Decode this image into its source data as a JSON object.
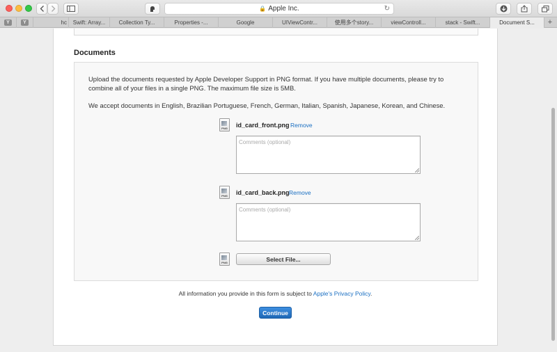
{
  "browser": {
    "address": "Apple Inc.",
    "pinned_tabs": [
      "Y",
      "Y"
    ],
    "tabs": [
      "hc",
      "Swift: Array...",
      "Collection Ty...",
      "Properties -...",
      "Google",
      "UIViewContr...",
      "使用多个story...",
      "viewControll...",
      "stack - Swift...",
      "Document S..."
    ],
    "new_tab_label": "+"
  },
  "page": {
    "section_title": "Documents",
    "intro_text": "Upload the documents requested by Apple Developer Support in PNG format. If you have multiple documents, please try to combine all of your files in a single PNG. The maximum file size is 5MB.",
    "accepted_text": "We accept documents in English, Brazilian Portuguese, French, German, Italian, Spanish, Japanese, Korean, and Chinese.",
    "files": [
      {
        "name": "id_card_front.png",
        "remove_label": "Remove",
        "comment_placeholder": "Comments (optional)",
        "ext": "PNG"
      },
      {
        "name": "id_card_back.png",
        "remove_label": "Remove",
        "comment_placeholder": "Comments (optional)",
        "ext": "PNG"
      }
    ],
    "select_file_label": "Select File...",
    "select_icon_ext": "PNG",
    "privacy_prefix": "All information you provide in this form is subject to ",
    "privacy_link": "Apple's Privacy Policy",
    "privacy_suffix": ".",
    "continue_label": "Continue"
  },
  "colors": {
    "link": "#1a6fc2",
    "primary_button": "#2a79cc",
    "secure_lock": "#28a745"
  },
  "icons": [
    "back-icon",
    "forward-icon",
    "sidebar-icon",
    "privacy-icon",
    "lock-icon",
    "reload-icon",
    "download-icon",
    "share-icon",
    "tabs-overview-icon",
    "png-file-icon"
  ]
}
